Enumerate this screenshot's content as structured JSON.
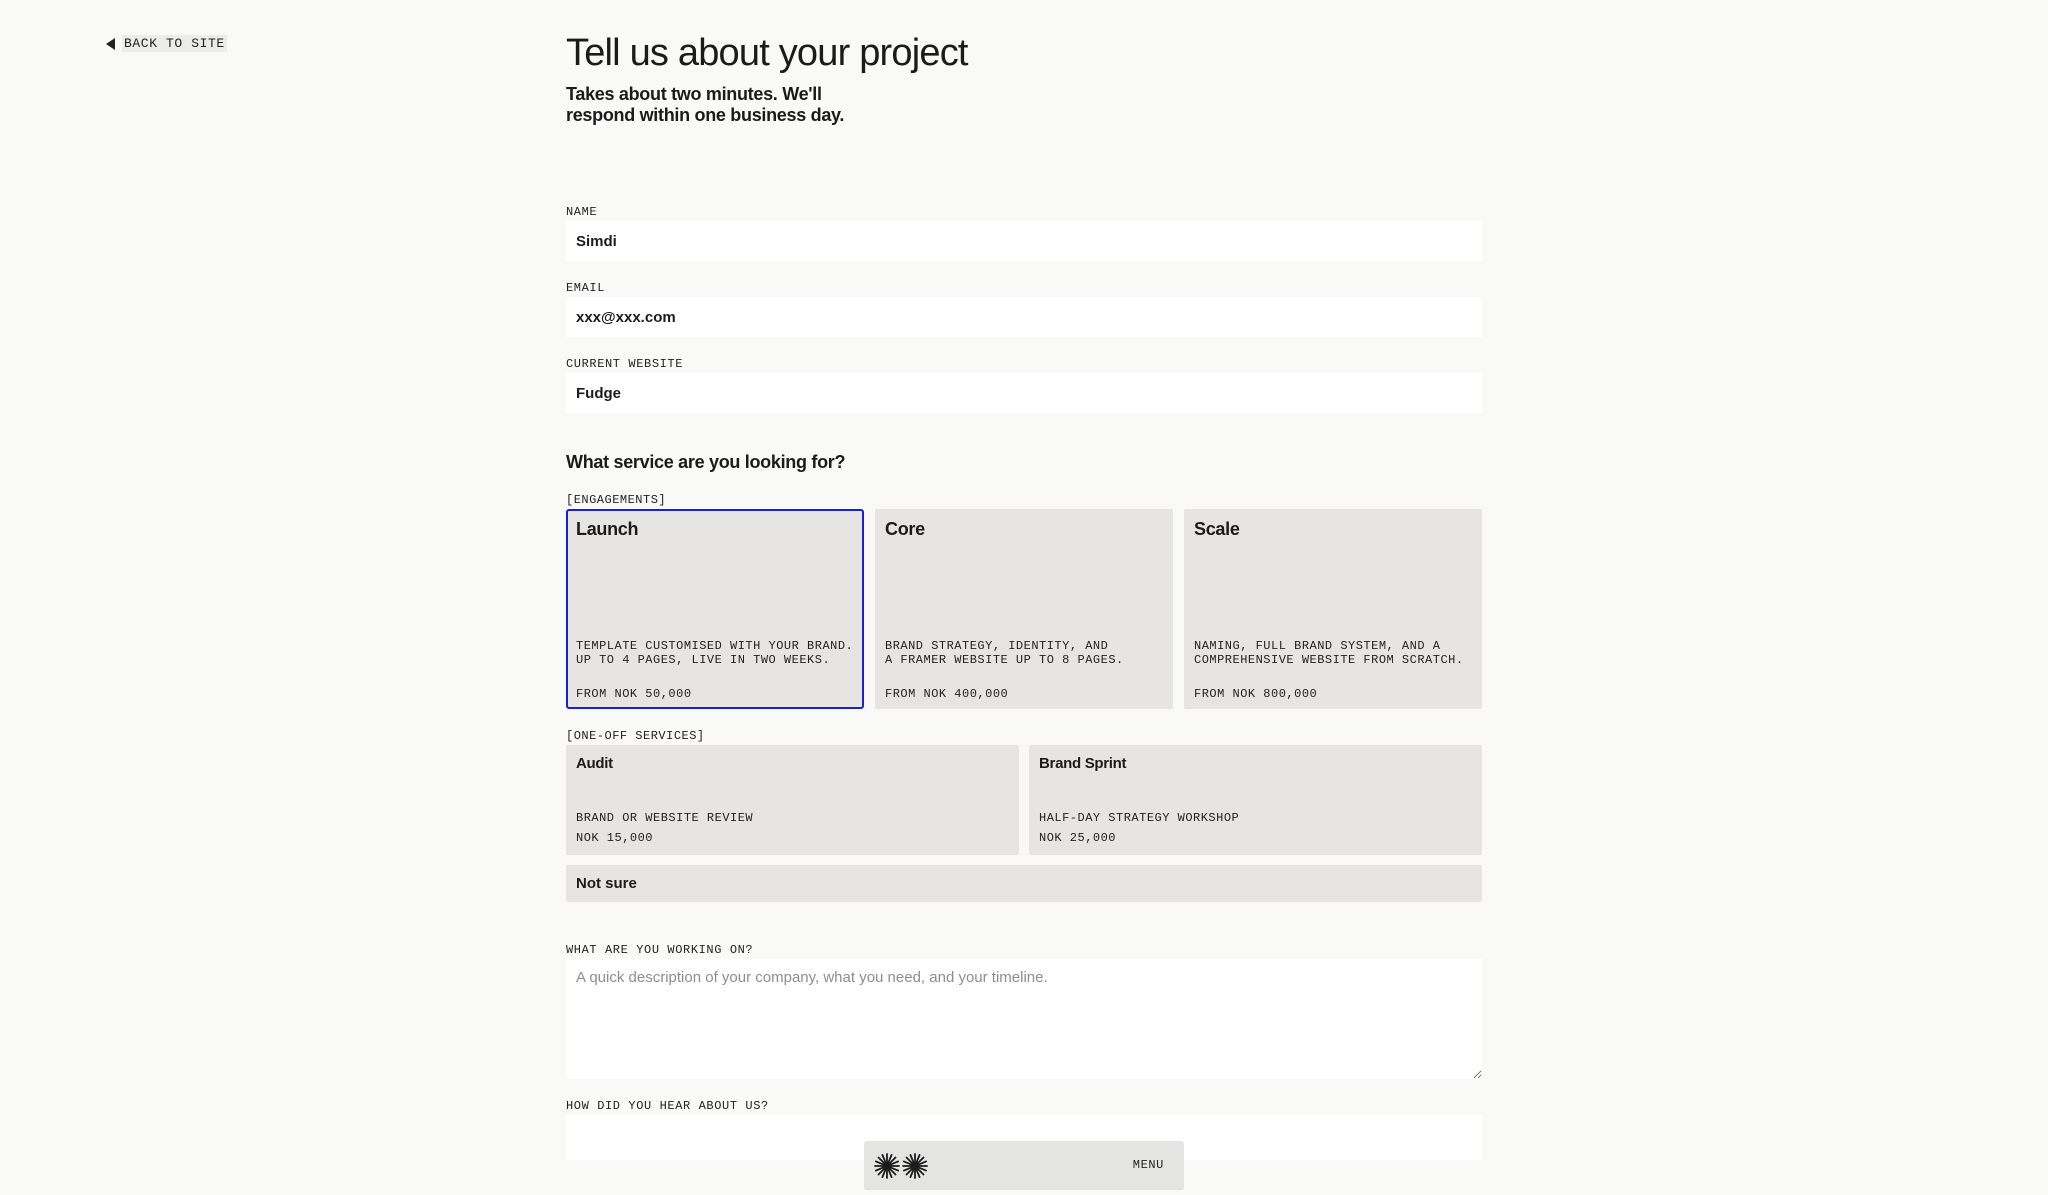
{
  "nav": {
    "back_label": "BACK TO SITE"
  },
  "header": {
    "title": "Tell us about your project",
    "subtitle": "Takes about two minutes. We'll respond within one business day."
  },
  "fields": {
    "name": {
      "label": "NAME",
      "value": "Simdi"
    },
    "email": {
      "label": "EMAIL",
      "value": "xxx@xxx.com"
    },
    "website": {
      "label": "CURRENT WEBSITE",
      "value": "Fudge"
    }
  },
  "service": {
    "heading": "What service are you looking for?",
    "engagements_label": "[ENGAGEMENTS]",
    "engagements": [
      {
        "title": "Launch",
        "description": "TEMPLATE CUSTOMISED WITH YOUR BRAND.\nUP TO 4 PAGES, LIVE IN TWO WEEKS.",
        "price": "FROM NOK 50,000",
        "selected": true
      },
      {
        "title": "Core",
        "description": "BRAND STRATEGY, IDENTITY, AND\nA FRAMER WEBSITE UP TO 8 PAGES.",
        "price": "FROM NOK 400,000",
        "selected": false
      },
      {
        "title": "Scale",
        "description": "NAMING, FULL BRAND SYSTEM, AND A\nCOMPREHENSIVE WEBSITE FROM SCRATCH.",
        "price": "FROM NOK 800,000",
        "selected": false
      }
    ],
    "oneoff_label": "[ONE-OFF SERVICES]",
    "oneoffs": [
      {
        "title": "Audit",
        "description": "BRAND OR WEBSITE REVIEW",
        "price": "NOK 15,000"
      },
      {
        "title": "Brand Sprint",
        "description": "HALF-DAY STRATEGY WORKSHOP",
        "price": "NOK 25,000"
      }
    ],
    "not_sure_label": "Not sure"
  },
  "project": {
    "label": "WHAT ARE YOU WORKING ON?",
    "placeholder": "A quick description of your company, what you need, and your timeline.",
    "value": ""
  },
  "referral": {
    "label": "HOW DID YOU HEAR ABOUT US?",
    "value": ""
  },
  "bottom_bar": {
    "menu_label": "MENU",
    "logo_icon": "sunburst-icon"
  },
  "colors": {
    "background": "#f9f9f8",
    "card": "#e6e5e3",
    "selected_border": "#1a1fcf",
    "input": "#ffffff"
  }
}
